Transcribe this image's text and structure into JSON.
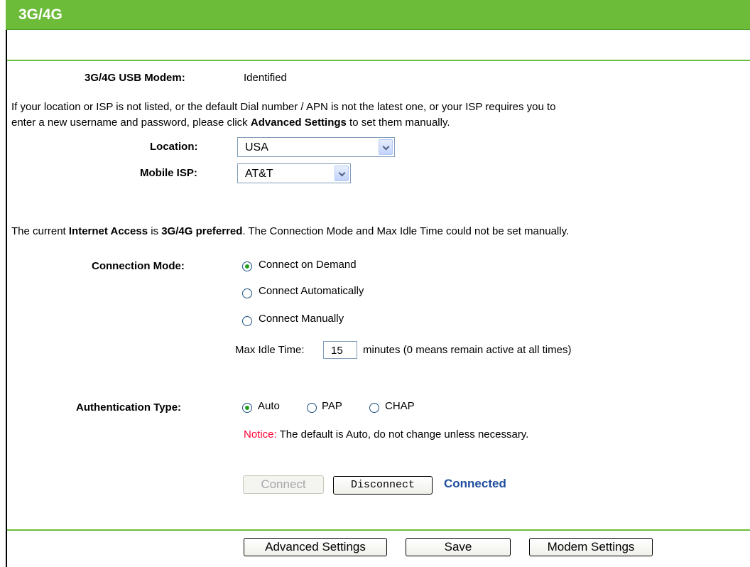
{
  "header": {
    "title": "3G/4G"
  },
  "modem": {
    "label": "3G/4G USB Modem:",
    "status": "Identified"
  },
  "info": {
    "line1": "If your location or ISP is not listed, or the default Dial number / APN is not the latest one, or your ISP requires you to",
    "line2_pre": "enter a new username and password, please click ",
    "line2_bold": "Advanced Settings",
    "line2_post": " to set them manually."
  },
  "location": {
    "label": "Location:",
    "value": "USA"
  },
  "mobile_isp": {
    "label": "Mobile ISP:",
    "value": "AT&T"
  },
  "internet_access": {
    "pre": "The current ",
    "bold1": "Internet Access",
    "mid": " is ",
    "bold2": "3G/4G preferred",
    "post": ". The Connection Mode and Max Idle Time could not be set manually."
  },
  "connection_mode": {
    "label": "Connection Mode:",
    "options": [
      "Connect on Demand",
      "Connect Automatically",
      "Connect Manually"
    ],
    "selected": "Connect on Demand"
  },
  "max_idle": {
    "label": "Max Idle Time:",
    "value": "15",
    "suffix": "minutes (0 means remain active at all times)"
  },
  "auth": {
    "label": "Authentication Type:",
    "options": [
      "Auto",
      "PAP",
      "CHAP"
    ],
    "selected": "Auto",
    "notice_prefix": "Notice:",
    "notice_text": " The default is Auto, do not change unless necessary."
  },
  "actions": {
    "connect": "Connect",
    "disconnect": "Disconnect",
    "status": "Connected"
  },
  "footer": {
    "advanced": "Advanced Settings",
    "save": "Save",
    "modem": "Modem Settings"
  },
  "colors": {
    "header_green": "#6cbc3a",
    "status_blue": "#1f4e9e",
    "notice_red": "#ff0033"
  }
}
